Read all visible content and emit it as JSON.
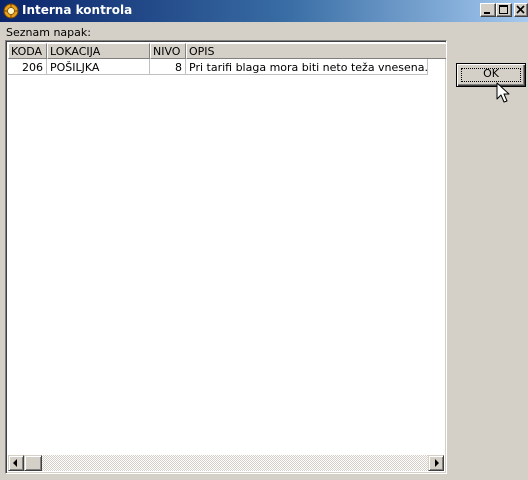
{
  "window": {
    "title": "Interna kontrola",
    "controls": [
      "minimize-icon",
      "maximize-icon",
      "close-icon"
    ]
  },
  "list_label": "Seznam napak:",
  "columns": [
    "KODA",
    "LOKACIJA",
    "NIVO",
    "OPIS"
  ],
  "rows": [
    {
      "koda": "206",
      "lokacija": "POŠILJKA",
      "nivo": "8",
      "opis": "Pri tarifi blaga mora biti neto teža vnesena."
    }
  ],
  "ok_button": "OK",
  "colors": {
    "title_gradient_start": "#0a246a",
    "title_gradient_end": "#a6caf0",
    "face": "#d4d0c8"
  }
}
